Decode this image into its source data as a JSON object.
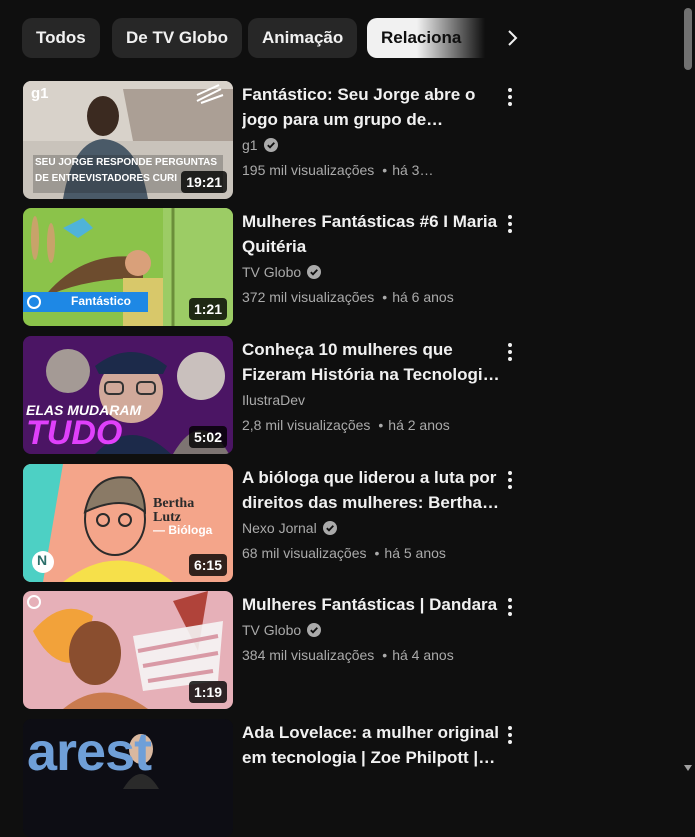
{
  "chips": [
    {
      "label": "Todos"
    },
    {
      "label": "De TV Globo"
    },
    {
      "label": "Animação"
    },
    {
      "label": "Relaciona"
    }
  ],
  "videos": [
    {
      "title": "Fantástico: Seu Jorge abre o jogo para um grupo de…",
      "channel": "g1",
      "verified": true,
      "views": "195 mil visualizações",
      "age": "há 3…",
      "duration": "19:21",
      "thumb_text": [
        "g1",
        "SEU JORGE RESPONDE PERGUNTAS",
        "DE ENTREVISTADORES CURI"
      ]
    },
    {
      "title": "Mulheres Fantásticas #6 I Maria Quitéria",
      "channel": "TV Globo",
      "verified": true,
      "views": "372 mil visualizações",
      "age": "há 6 anos",
      "duration": "1:21",
      "thumb_text": [
        "Fantástico"
      ]
    },
    {
      "title": "Conheça 10 mulheres que Fizeram História na Tecnologi…",
      "channel": "IlustraDev",
      "verified": false,
      "views": "2,8 mil visualizações",
      "age": "há 2 anos",
      "duration": "5:02",
      "thumb_text": [
        "ELAS MUDARAM",
        "TUDO"
      ]
    },
    {
      "title": "A bióloga que liderou a luta por direitos das mulheres: Bertha…",
      "channel": "Nexo Jornal",
      "verified": true,
      "views": "68 mil visualizações",
      "age": "há 5 anos",
      "duration": "6:15",
      "thumb_text": [
        "Bertha",
        "Lutz",
        "— Bióloga",
        "N"
      ]
    },
    {
      "title": "Mulheres Fantásticas | Dandara",
      "channel": "TV Globo",
      "verified": true,
      "views": "384 mil visualizações",
      "age": "há 4 anos",
      "duration": "1:19",
      "thumb_text": []
    },
    {
      "title": "Ada Lovelace: a mulher original em tecnologia | Zoe Philpott |…",
      "channel": "",
      "verified": false,
      "views": "",
      "age": "",
      "duration": "",
      "thumb_text": [
        "arest"
      ]
    }
  ],
  "colors": {
    "background": "#0f0f0f",
    "chip": "#272727",
    "chip_active": "#f1f1f1",
    "secondary_text": "#aaaaaa"
  }
}
